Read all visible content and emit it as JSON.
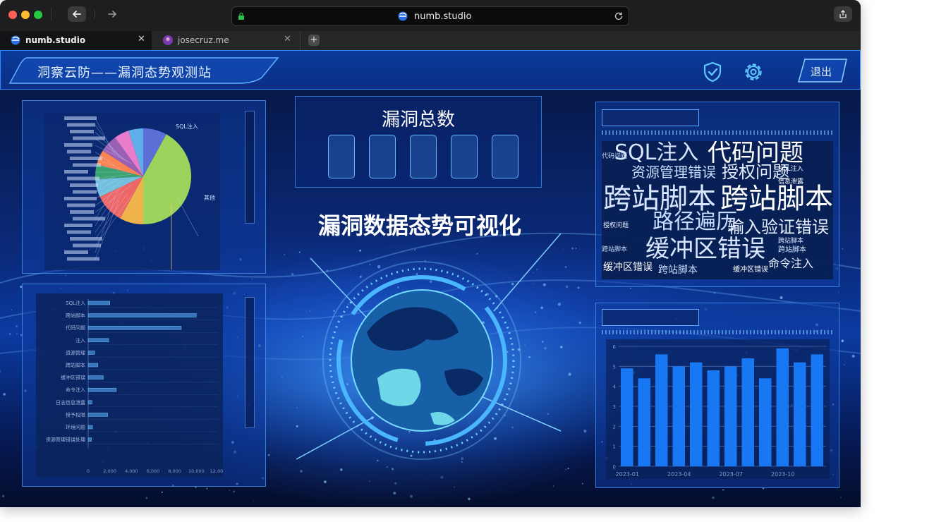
{
  "browser": {
    "url": "numb.studio",
    "tabs": [
      {
        "label": "numb.studio",
        "active": true
      },
      {
        "label": "josecruz.me",
        "active": false
      }
    ],
    "new_tab_symbol": "+"
  },
  "header": {
    "title": "洞察云防——漏洞态势观测站",
    "logout_label": "退出",
    "icons": [
      "shield-check-icon",
      "gear-icon"
    ]
  },
  "center": {
    "total_title": "漏洞总数",
    "digit_boxes": 5,
    "headline": "漏洞数据态势可视化"
  },
  "pie": {
    "top_label": "SQL注入",
    "right_label": "其他",
    "slices": [
      {
        "value": 0.08,
        "color": "#5b6fd6"
      },
      {
        "value": 0.42,
        "color": "#9bd35c"
      },
      {
        "value": 0.08,
        "color": "#f0b24a"
      },
      {
        "value": 0.1,
        "color": "#ee6666"
      },
      {
        "value": 0.06,
        "color": "#73c0de"
      },
      {
        "value": 0.05,
        "color": "#3ba272"
      },
      {
        "value": 0.05,
        "color": "#fc8452"
      },
      {
        "value": 0.06,
        "color": "#9a60b4"
      },
      {
        "value": 0.05,
        "color": "#ea7ccc"
      },
      {
        "value": 0.05,
        "color": "#5fb0e8"
      }
    ]
  },
  "hbar": {
    "categories": [
      "SQL注入",
      "跨站脚本",
      "代码问题",
      "注入",
      "资源管理",
      "跨站脚本",
      "缓冲区错误",
      "命令注入",
      "日志信息泄露",
      "授予权限",
      "环境问题",
      "资源管理错误处理"
    ],
    "values": [
      2000,
      10000,
      8600,
      1900,
      600,
      900,
      1400,
      2600,
      350,
      1800,
      400,
      300
    ],
    "xticks": [
      "0",
      "2,000",
      "4,000",
      "6,000",
      "8,000",
      "10,000",
      "12,000"
    ],
    "xmax": 12000
  },
  "wordcloud": {
    "words": [
      {
        "text": "SQL注入",
        "size": 30
      },
      {
        "text": "代码问题",
        "size": 34
      },
      {
        "text": "资源管理错误",
        "size": 20
      },
      {
        "text": "授权问题",
        "size": 24
      },
      {
        "text": "跨站脚本",
        "size": 40
      },
      {
        "text": "跨站脚本",
        "size": 40
      },
      {
        "text": "路径遍历",
        "size": 30
      },
      {
        "text": "输入验证错误",
        "size": 24
      },
      {
        "text": "缓冲区错误",
        "size": 34
      },
      {
        "text": "缓冲区错误",
        "size": 14
      },
      {
        "text": "跨站脚本",
        "size": 14
      },
      {
        "text": "命令注入",
        "size": 16
      },
      {
        "text": "跨站脚本",
        "size": 10
      },
      {
        "text": "缓冲区错误",
        "size": 10
      },
      {
        "text": "代码问题",
        "size": 9
      },
      {
        "text": "授权问题",
        "size": 9
      },
      {
        "text": "跨站脚本",
        "size": 9
      },
      {
        "text": "信息泄露",
        "size": 9
      },
      {
        "text": "跨站脚本",
        "size": 9
      },
      {
        "text": "SQL注入",
        "size": 9
      }
    ]
  },
  "chart_data": [
    {
      "type": "pie",
      "labels": [
        "SQL注入",
        "其他"
      ],
      "values": [
        8,
        42,
        8,
        10,
        6,
        5,
        5,
        6,
        5,
        5
      ]
    },
    {
      "type": "bar",
      "orientation": "horizontal",
      "categories": [
        "SQL注入",
        "跨站脚本",
        "代码问题",
        "注入",
        "资源管理",
        "跨站脚本",
        "缓冲区错误",
        "命令注入",
        "日志信息泄露",
        "授予权限",
        "环境问题",
        "资源管理错误处理"
      ],
      "values": [
        2000,
        10000,
        8600,
        1900,
        600,
        900,
        1400,
        2600,
        350,
        1800,
        400,
        300
      ],
      "xlim": [
        0,
        12000
      ]
    },
    {
      "type": "bar",
      "x": [
        "2023-01",
        "2023-02",
        "2023-03",
        "2023-04",
        "2023-05",
        "2023-06",
        "2023-07",
        "2023-08",
        "2023-09",
        "2023-10",
        "2023-11",
        "2023-12"
      ],
      "xticks": [
        "2023-01",
        "2023-04",
        "2023-07",
        "2023-10"
      ],
      "values": [
        4.9,
        4.4,
        5.6,
        5.0,
        5.2,
        4.8,
        5.0,
        5.4,
        4.4,
        5.9,
        5.2,
        5.6
      ],
      "ylim": [
        0,
        6
      ],
      "yticks": [
        "0",
        "1",
        "2",
        "3",
        "4",
        "5",
        "6"
      ]
    }
  ],
  "colors": {
    "accent": "#2f8cff",
    "bar": "#1877f2",
    "header": "#0b2f86"
  }
}
